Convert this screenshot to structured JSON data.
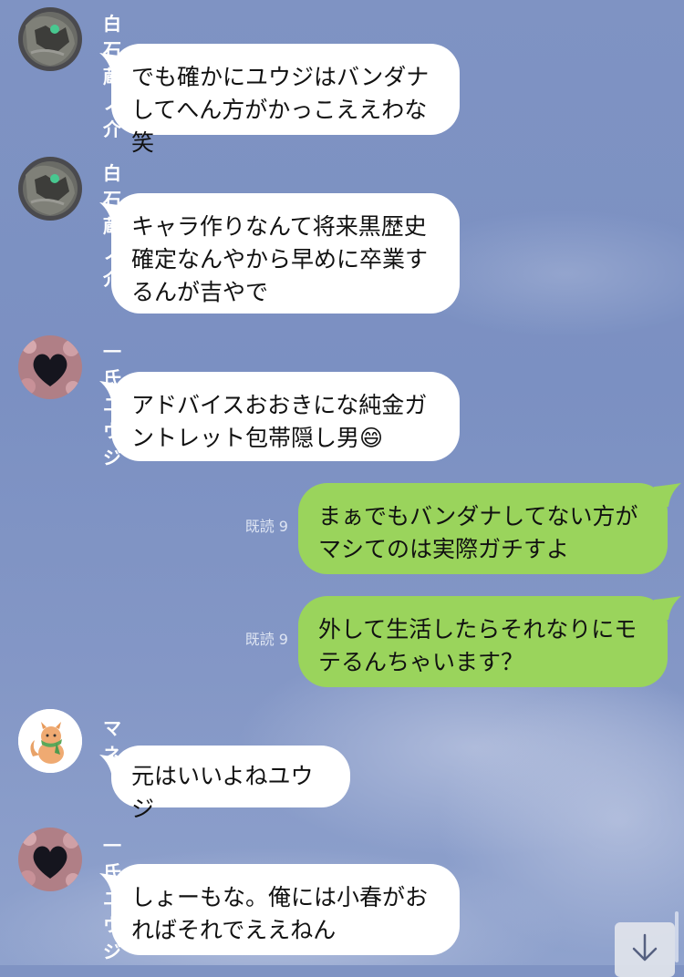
{
  "chat": {
    "messages": [
      {
        "sender": "白石蔵ノ介",
        "text": "でも確かにユウジはバンダナしてへん方がかっこええわな笑"
      },
      {
        "sender": "白石蔵ノ介",
        "text": "キャラ作りなんて将来黒歴史確定なんやから早めに卒業するんが吉やで"
      },
      {
        "sender": "一氏ユウジ",
        "text": "アドバイスおおきにな純金ガントレット包帯隠し男",
        "emoji": "😄"
      },
      {
        "read": "既読 9",
        "text": "まぁでもバンダナしてない方がマシてのは実際ガチすよ"
      },
      {
        "read": "既読 9",
        "text": "外して生活したらそれなりにモテるんちゃいます？"
      },
      {
        "sender": "マネ",
        "text": "元はいいよねユウジ"
      },
      {
        "sender": "一氏ユウジ",
        "text": "しょーもな。俺には小春がおればそれでええねん"
      }
    ]
  },
  "icons": {
    "scroll_down": "arrow-down-icon"
  },
  "colors": {
    "background": "#7f93c3",
    "incoming_bubble": "#ffffff",
    "outgoing_bubble": "#9ad45c",
    "sender_name": "#ffffff",
    "read_receipt": "#dde4f2"
  }
}
